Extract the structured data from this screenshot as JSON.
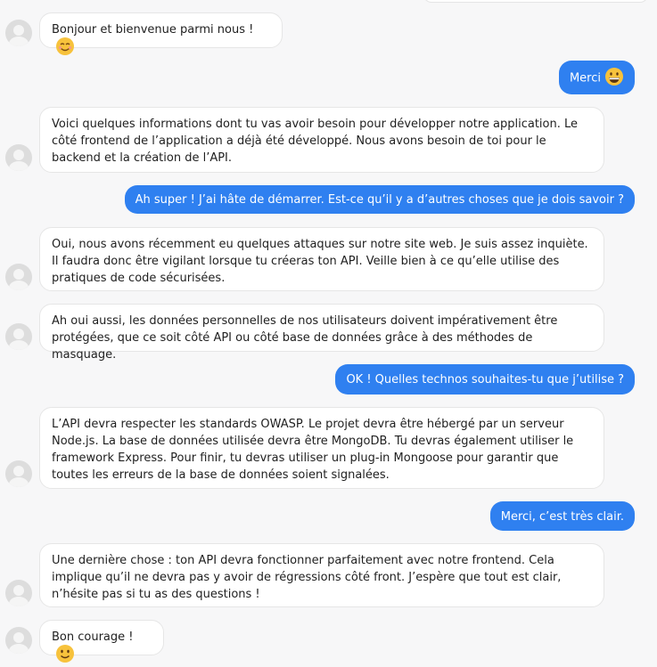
{
  "messages": [
    {
      "from": "bot",
      "text": "Bonjour et bienvenue parmi nous !",
      "emoji": "smiling-face-icon"
    },
    {
      "from": "user",
      "text": "Merci",
      "emoji": "grinning-face-icon"
    },
    {
      "from": "bot",
      "text": "Voici quelques informations dont tu vas avoir besoin pour développer notre application. Le côté frontend de l’application a déjà été développé. Nous avons besoin de toi pour le backend et la création de l’API."
    },
    {
      "from": "user",
      "text": "Ah super ! J’ai hâte de démarrer. Est-ce qu’il y a d’autres choses que je dois savoir ?"
    },
    {
      "from": "bot",
      "text": "Oui, nous avons récemment eu quelques attaques sur notre site web. Je suis assez inquiète. Il faudra donc être vigilant lorsque tu créeras ton API. Veille bien à ce qu’elle utilise des pratiques de code sécurisées."
    },
    {
      "from": "bot",
      "text": "Ah oui aussi, les données personnelles de nos utilisateurs doivent impérativement être protégées, que ce soit côté API ou côté base de données grâce à des méthodes de masquage."
    },
    {
      "from": "user",
      "text": "OK ! Quelles technos souhaites-tu que j’utilise ?"
    },
    {
      "from": "bot",
      "text": "L’API devra respecter les standards OWASP. Le projet devra être hébergé par un serveur Node.js. La base de données utilisée devra être MongoDB. Tu devras également utiliser le framework Express. Pour finir, tu devras utiliser un plug-in Mongoose pour garantir que toutes les erreurs de la base de données soient signalées."
    },
    {
      "from": "user",
      "text": "Merci, c’est très clair."
    },
    {
      "from": "bot",
      "text": "Une dernière chose : ton API devra fonctionner parfaitement avec notre frontend. Cela implique qu’il ne devra pas y avoir de régressions côté front. J’espère que tout est clair, n’hésite pas si tu as des questions !"
    },
    {
      "from": "bot",
      "text": "Bon courage !",
      "emoji": "slightly-smiling-face-icon"
    }
  ],
  "colors": {
    "user_bubble": "#2f80f0",
    "bot_bubble": "#ffffff",
    "background": "#f7f7f8"
  }
}
